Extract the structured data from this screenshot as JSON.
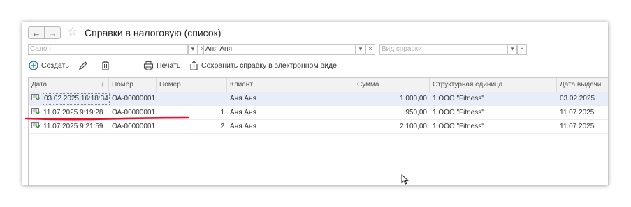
{
  "window": {
    "title": "Справки в налоговую (список)",
    "back_icon": "arrow-left-icon",
    "forward_icon": "arrow-right-icon",
    "favorite_icon": "star-icon"
  },
  "filters": {
    "salon": {
      "value": "",
      "placeholder": "Салон"
    },
    "client": {
      "value": "Аня Аня",
      "placeholder": ""
    },
    "doc_type": {
      "value": "",
      "placeholder": "Вид справки"
    }
  },
  "toolbar": {
    "create_label": "Создать",
    "print_label": "Печать",
    "save_electronic_label": "Сохранить справку в электронном виде"
  },
  "table": {
    "sort_indicator": "↓",
    "columns": [
      "Дата",
      "Номер",
      "Номер корректировки",
      "Клиент",
      "Сумма",
      "Структурная единица",
      "Дата выдачи"
    ],
    "rows": [
      {
        "date": "03.02.2025 16:18:34",
        "number": "ОА-00000001",
        "correction": "",
        "client": "Аня Аня",
        "sum": "1 000,00",
        "unit": "1.ООО \"Fitness\"",
        "issue_date": "03.02.2025",
        "selected": true
      },
      {
        "date": "11.07.2025 9:19:28",
        "number": "ОА-00000001",
        "correction": "1",
        "client": "Аня Аня",
        "sum": "950,00",
        "unit": "1.ООО \"Fitness\"",
        "issue_date": "11.07.2025",
        "selected": false
      },
      {
        "date": "11.07.2025 9:21:59",
        "number": "ОА-00000001",
        "correction": "2",
        "client": "Аня Аня",
        "sum": "2 100,00",
        "unit": "1.ООО \"Fitness\"",
        "issue_date": "11.07.2025",
        "selected": false
      }
    ]
  },
  "colors": {
    "selected_row": "#e7eef9",
    "annotation_line": "#e8112d",
    "create_icon": "#2a6ec9"
  }
}
